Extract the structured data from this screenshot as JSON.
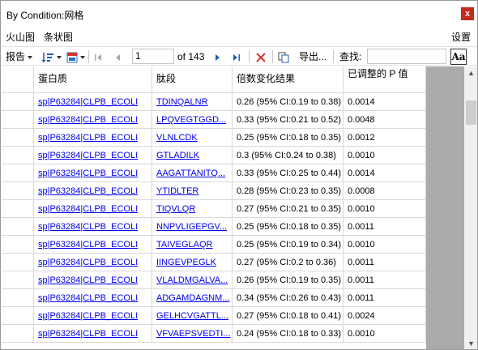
{
  "window": {
    "title": "By Condition:网格",
    "close_label": "x"
  },
  "menu": {
    "volcano": "火山图",
    "bar": "条状图",
    "settings": "设置"
  },
  "toolbar": {
    "report": "报告",
    "page": "1",
    "of_pages": "of 143",
    "export": "导出...",
    "find": "查找:",
    "font_button": "Aa"
  },
  "columns": [
    "蛋白质",
    "肽段",
    "倍数变化结果",
    "已调整的 P 值"
  ],
  "rows": [
    {
      "protein": "sp|P63284|CLPB_ECOLI",
      "peptide": "TDINQALNR",
      "fold": "0.26 (95% CI:0.19 to 0.38)",
      "p": "0.0014"
    },
    {
      "protein": "sp|P63284|CLPB_ECOLI",
      "peptide": "LPQVEGTGGD...",
      "fold": "0.33 (95% CI:0.21 to 0.52)",
      "p": "0.0048"
    },
    {
      "protein": "sp|P63284|CLPB_ECOLI",
      "peptide": "VLNLCDK",
      "fold": "0.25 (95% CI:0.18 to 0.35)",
      "p": "0.0012"
    },
    {
      "protein": "sp|P63284|CLPB_ECOLI",
      "peptide": "GTLADILK",
      "fold": "0.3 (95% CI:0.24 to 0.38)",
      "p": "0.0010"
    },
    {
      "protein": "sp|P63284|CLPB_ECOLI",
      "peptide": "AAGATTANITQ...",
      "fold": "0.33 (95% CI:0.25 to 0.44)",
      "p": "0.0014"
    },
    {
      "protein": "sp|P63284|CLPB_ECOLI",
      "peptide": "YTIDLTER",
      "fold": "0.28 (95% CI:0.23 to 0.35)",
      "p": "0.0008"
    },
    {
      "protein": "sp|P63284|CLPB_ECOLI",
      "peptide": "TIQVLQR",
      "fold": "0.27 (95% CI:0.21 to 0.35)",
      "p": "0.0010"
    },
    {
      "protein": "sp|P63284|CLPB_ECOLI",
      "peptide": "NNPVLIGEPGV...",
      "fold": "0.25 (95% CI:0.18 to 0.35)",
      "p": "0.0011"
    },
    {
      "protein": "sp|P63284|CLPB_ECOLI",
      "peptide": "TAIVEGLAQR",
      "fold": "0.25 (95% CI:0.19 to 0.34)",
      "p": "0.0010"
    },
    {
      "protein": "sp|P63284|CLPB_ECOLI",
      "peptide": "IINGEVPEGLK",
      "fold": "0.27 (95% CI:0.2 to 0.36)",
      "p": "0.0011"
    },
    {
      "protein": "sp|P63284|CLPB_ECOLI",
      "peptide": "VLALDMGALVA...",
      "fold": "0.26 (95% CI:0.19 to 0.35)",
      "p": "0.0011"
    },
    {
      "protein": "sp|P63284|CLPB_ECOLI",
      "peptide": "ADGAMDAGNM...",
      "fold": "0.34 (95% CI:0.26 to 0.43)",
      "p": "0.0011"
    },
    {
      "protein": "sp|P63284|CLPB_ECOLI",
      "peptide": "GELHCVGATTL...",
      "fold": "0.27 (95% CI:0.18 to 0.41)",
      "p": "0.0024"
    },
    {
      "protein": "sp|P63284|CLPB_ECOLI",
      "peptide": "VFVAEPSVEDTI...",
      "fold": "0.24 (95% CI:0.18 to 0.33)",
      "p": "0.0010"
    }
  ]
}
